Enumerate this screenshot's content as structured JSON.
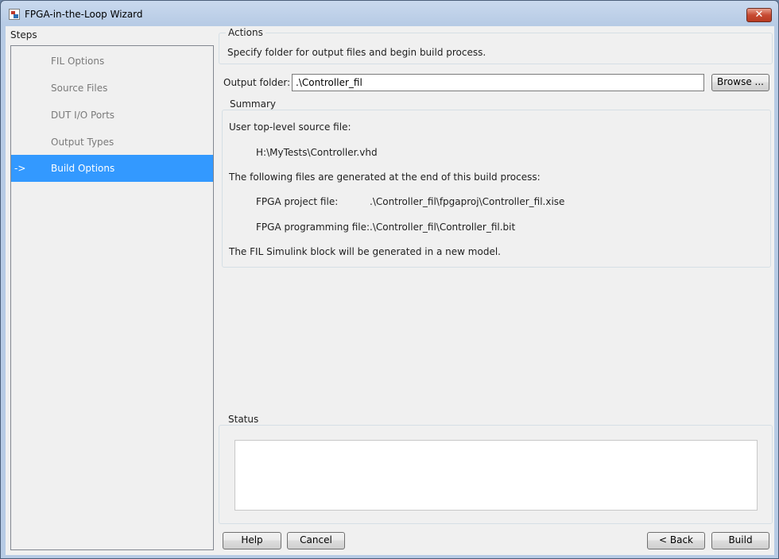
{
  "window": {
    "title": "FPGA-in-the-Loop Wizard",
    "close_glyph": "✕"
  },
  "steps": {
    "label": "Steps",
    "items": [
      {
        "label": "FIL Options",
        "marker": ""
      },
      {
        "label": "Source Files",
        "marker": ""
      },
      {
        "label": "DUT I/O Ports",
        "marker": ""
      },
      {
        "label": "Output Types",
        "marker": ""
      },
      {
        "label": "Build Options",
        "marker": "->"
      }
    ],
    "active_index": 4
  },
  "actions": {
    "title": "Actions",
    "description": "Specify folder for output files and begin build process."
  },
  "output_folder": {
    "label": "Output folder:",
    "value": ".\\Controller_fil",
    "browse_label": "Browse ..."
  },
  "summary": {
    "title": "Summary",
    "source_heading": "User top-level source file:",
    "source_path": "H:\\MyTests\\Controller.vhd",
    "generated_heading": "The following files are generated at the end of this build process:",
    "project_label": "FPGA project file:",
    "project_path": ".\\Controller_fil\\fpgaproj\\Controller_fil.xise",
    "programming_label": "FPGA programming file:",
    "programming_path": ".\\Controller_fil\\Controller_fil.bit",
    "block_note": "The FIL Simulink block will be generated in a new model."
  },
  "status": {
    "title": "Status",
    "content": ""
  },
  "footer": {
    "help_label": "Help",
    "cancel_label": "Cancel",
    "back_label": "< Back",
    "build_label": "Build"
  }
}
